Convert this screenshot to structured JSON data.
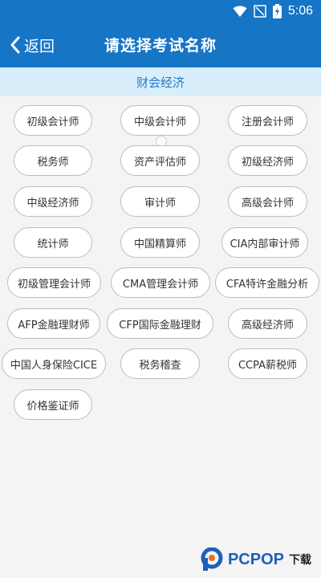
{
  "status": {
    "time": "5:06",
    "icons": [
      "wifi-icon",
      "no-signal-icon",
      "battery-charging-icon"
    ]
  },
  "appbar": {
    "back_label": "返回",
    "title": "请选择考试名称"
  },
  "category": {
    "label": "财会经济"
  },
  "exams": [
    "初级会计师",
    "中级会计师",
    "注册会计师",
    "税务师",
    "资产评估师",
    "初级经济师",
    "中级经济师",
    "审计师",
    "高级会计师",
    "统计师",
    "中国精算师",
    "CIA内部审计师",
    "初级管理会计师",
    "CMA管理会计师",
    "CFA特许金融分析",
    "AFP金融理财师",
    "CFP国际金融理财",
    "高级经济师",
    "中国人身保险CICE",
    "税务稽查",
    "CCPA薪税师",
    "价格鉴证师"
  ],
  "watermark": {
    "brand": "PCPOP",
    "suffix": "下载"
  },
  "colors": {
    "primary": "#1775c6",
    "category_bg": "#d9eefb",
    "category_text": "#1f7ac8"
  }
}
